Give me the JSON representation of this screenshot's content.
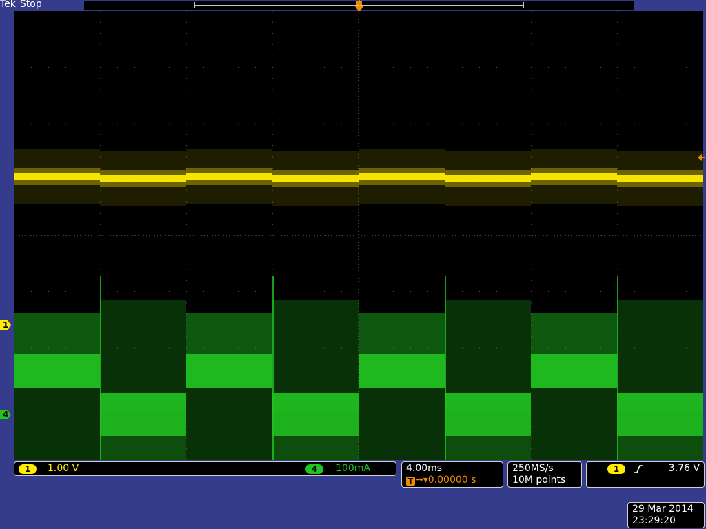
{
  "header": {
    "brand": "Tek",
    "acq_state": "Stop"
  },
  "trigger": {
    "marker_label": "T",
    "position_value": "0.00000 s"
  },
  "channels": {
    "ch1": {
      "number": "1",
      "scale": "1.00 V",
      "color": "#ffec00"
    },
    "ch4": {
      "number": "4",
      "scale": "100mA",
      "color": "#21c421"
    }
  },
  "horizontal": {
    "timebase": "4.00ms",
    "delay": "0.00000 s"
  },
  "acquisition": {
    "sample_rate": "250MS/s",
    "record_length": "10M points"
  },
  "trigger_panel": {
    "source": "1",
    "slope_icon": "rising-edge-icon",
    "level": "3.76 V"
  },
  "datetime": {
    "date": "29 Mar 2014",
    "time": "23:29:20"
  },
  "colors": {
    "frame": "#363c8c",
    "trigger": "#f08c00",
    "graticule": "#8a8a8a"
  }
}
